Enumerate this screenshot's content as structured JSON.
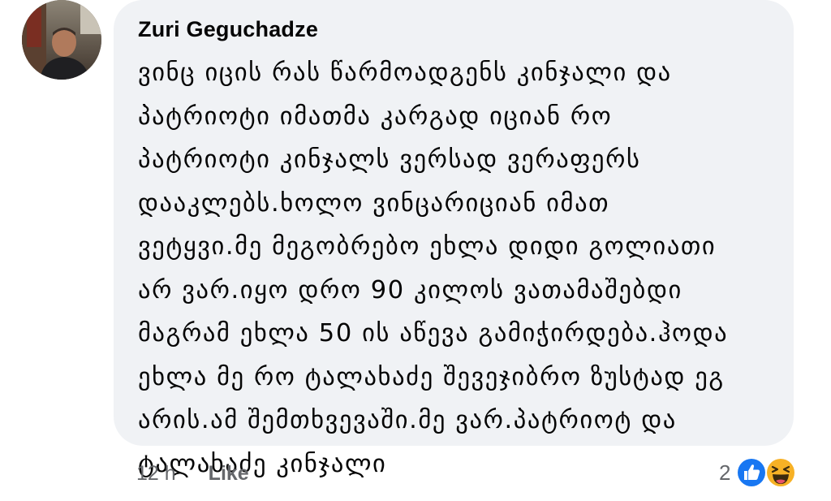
{
  "comment": {
    "author": "Zuri Geguchadze",
    "lines": [
      "ვინც იცის რას წარმოადგენს კინჯალი და",
      "პატრიოტი იმათმა კარგად იციან რო",
      "პატრიოტი კინჯალს ვერსად ვერაფერს",
      "დააკლებს.ხოლო ვინცარიციან იმათ",
      "ვეტყვი.მე მეგობრებო ეხლა დიდი გოლიათი",
      "არ ვარ.იყო დრო 90 კილოს ვათამაშებდი",
      "მაგრამ ეხლა 50 ის აწევა გამიჭირდება.ჰოდა",
      "ეხლა მე რო ტალახაძე შევეჯიბრო ზუსტად ეგ",
      "არის.ამ შემთხვევაში.მე ვარ.პატრიოტ და",
      "ტალახაძე კინჯალი"
    ],
    "time": "12 h",
    "like_label": "Like",
    "reaction_count": "2",
    "reaction_icons": [
      "like-icon",
      "haha-icon"
    ]
  },
  "colors": {
    "bubble_bg": "#f0f2f5",
    "text": "#050505",
    "secondary": "#65676b",
    "like_blue": "#1877f2",
    "haha_yellow": "#f7b125"
  }
}
